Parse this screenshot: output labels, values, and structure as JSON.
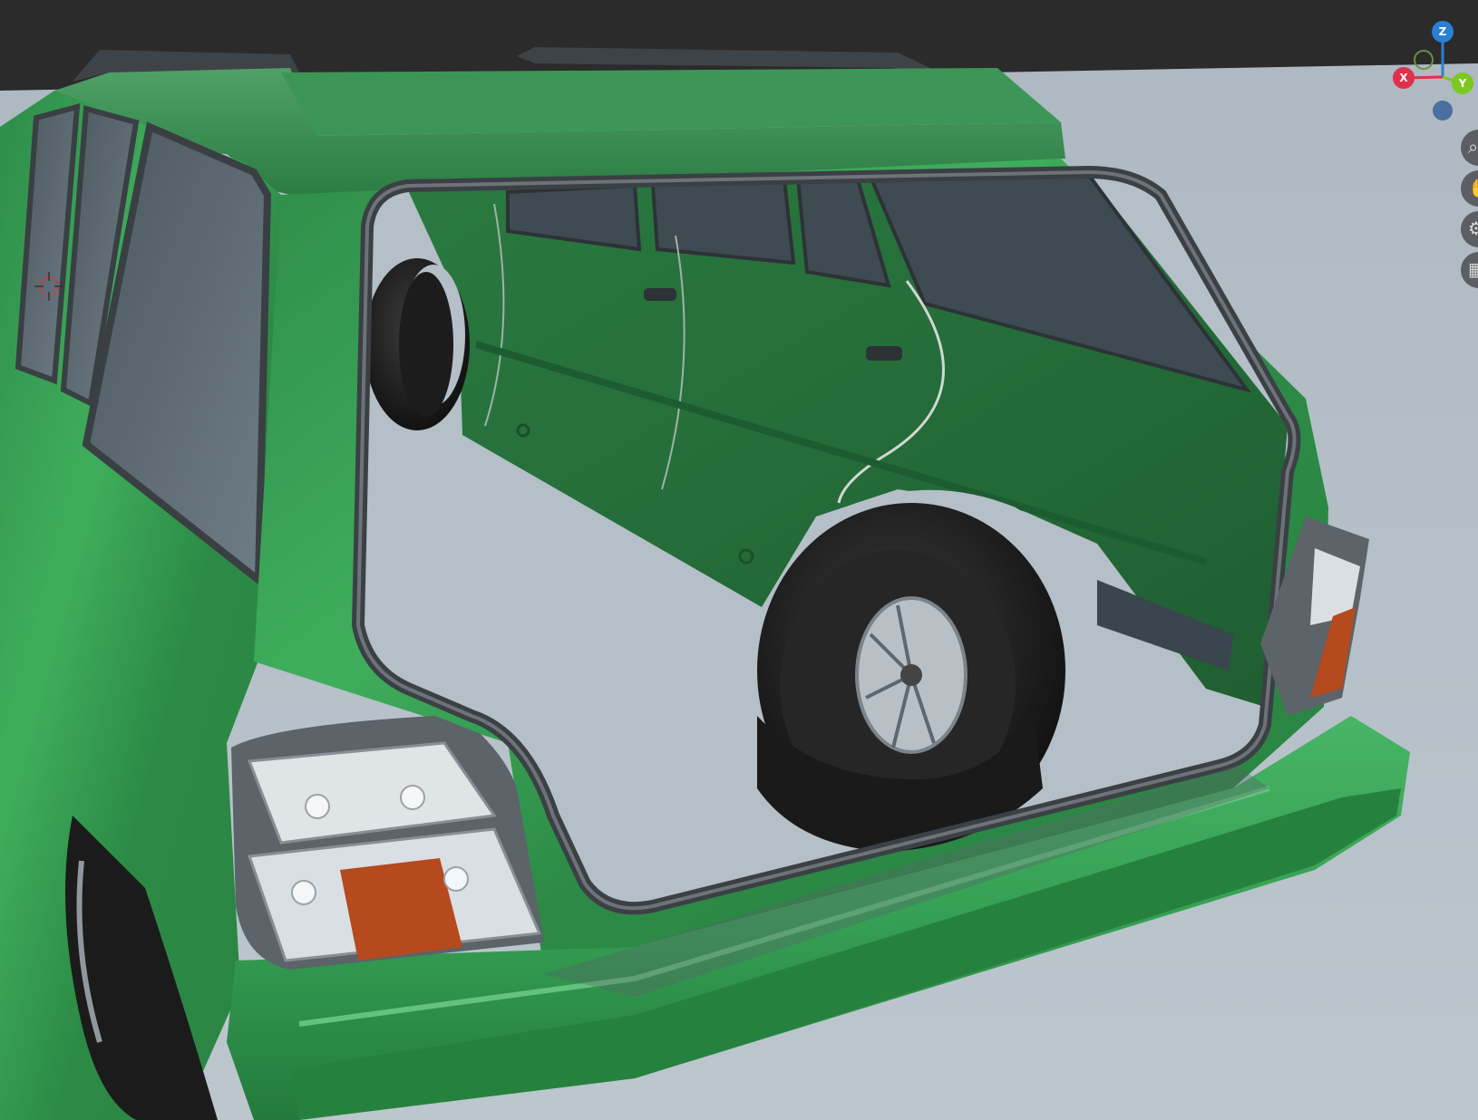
{
  "viewport": {
    "mode": "3d-viewport",
    "grid_background_color": "#2b2b2b",
    "floor_color": "#b5c0c8",
    "model_color": "#2f9a4e"
  },
  "gizmo": {
    "z_label": "Z",
    "x_label": "X",
    "y_label": "Y",
    "z_color": "#2b7fd4",
    "x_color": "#e0304a",
    "y_color": "#7cc81e",
    "neg_color": "#4a6fa0"
  },
  "tools": [
    {
      "name": "zoom-icon",
      "glyph": "⌕"
    },
    {
      "name": "pan-hand-icon",
      "glyph": "✋"
    },
    {
      "name": "camera-icon",
      "glyph": "⚙"
    },
    {
      "name": "grid-icon",
      "glyph": "▦"
    }
  ],
  "cursor_3d": {
    "name": "3d-cursor-icon"
  }
}
